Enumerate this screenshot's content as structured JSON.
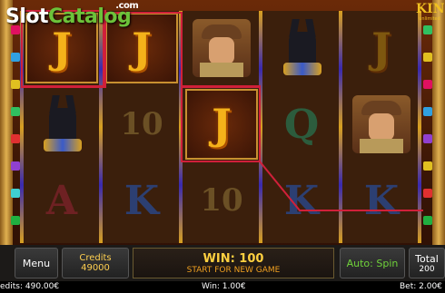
{
  "logo": {
    "part1": "Slot",
    "part2": "Catalog",
    "suffix": ".com"
  },
  "game_logo": {
    "title": "KING",
    "subtitle": "unlimited"
  },
  "reels": [
    [
      "J",
      "anubis",
      "A"
    ],
    [
      "J",
      "10",
      "K"
    ],
    [
      "explorer",
      "J",
      "10"
    ],
    [
      "anubis",
      "Q",
      "K"
    ],
    [
      "J",
      "explorer",
      "K"
    ]
  ],
  "controls": {
    "menu_label": "Menu",
    "credits_label": "Credits",
    "credits_value": "49000",
    "win_text": "WIN: 100",
    "start_text": "START FOR NEW GAME",
    "autospin_label": "Auto: Spin",
    "total_label": "Total",
    "total_value": "200"
  },
  "status": {
    "credits": "edits: 490.00€",
    "win": "Win: 1.00€",
    "bet": "Bet: 2.00€"
  },
  "colors": {
    "win_line": "#d0203a",
    "accent_gold": "#f4b21a",
    "autospin_green": "#6fd23a"
  }
}
